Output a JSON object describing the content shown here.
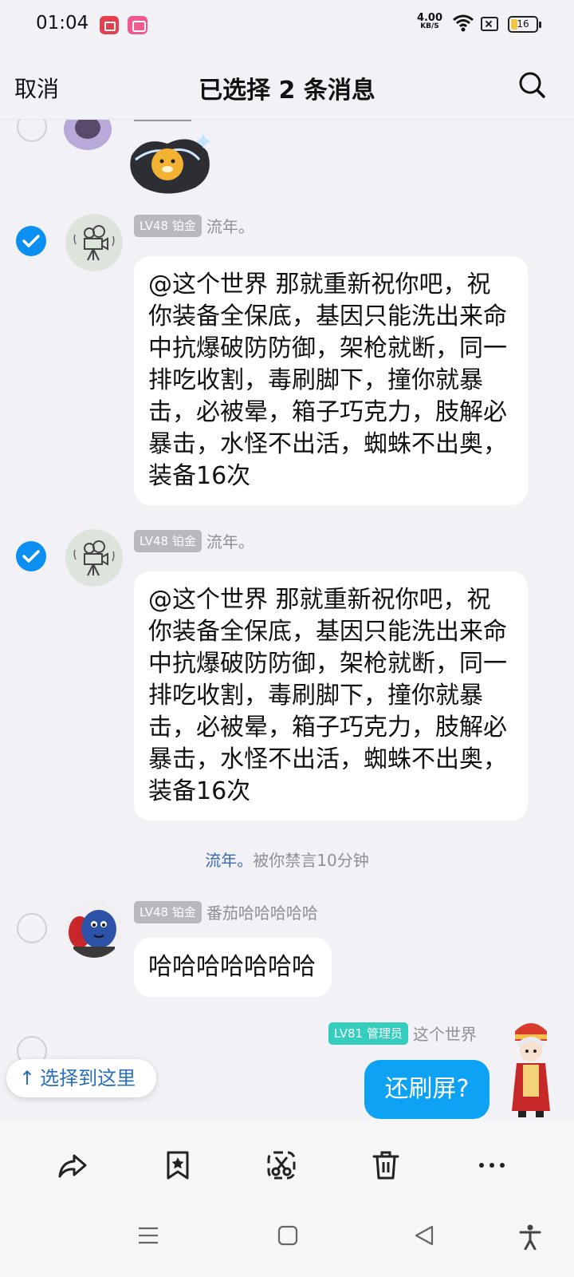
{
  "status_bar": {
    "time": "01:04",
    "net_speed_value": "4.00",
    "net_speed_unit": "KB/S",
    "battery": "16",
    "icons": [
      "screen-record-icon",
      "bilibili-app-icon",
      "wifi-icon",
      "no-sim-icon",
      "battery-icon"
    ]
  },
  "header": {
    "cancel_label": "取消",
    "title": "已选择 2 条消息",
    "search_icon": "search-icon"
  },
  "messages": [
    {
      "selected": true,
      "badge": "LV48 铂金",
      "nickname": "流年。",
      "text": "@这个世界 那就重新祝你吧，祝你装备全保底，基因只能洗出来命中抗爆破防防御，架枪就断，同一排吃收割，毒刷脚下，撞你就暴击，必被晕，箱子巧克力，肢解必暴击，水怪不出活，蜘蛛不出奥，装备16次"
    },
    {
      "selected": true,
      "badge": "LV48 铂金",
      "nickname": "流年。",
      "text": "@这个世界 那就重新祝你吧，祝你装备全保底，基因只能洗出来命中抗爆破防防御，架枪就断，同一排吃收割，毒刷脚下，撞你就暴击，必被晕，箱子巧克力，肢解必暴击，水怪不出活，蜘蛛不出奥，装备16次"
    },
    {
      "selected": false,
      "badge": "LV48 铂金",
      "nickname": "番茄哈哈哈哈哈",
      "text": "哈哈哈哈哈哈哈"
    },
    {
      "selected": false,
      "badge": "LV81 管理员",
      "nickname": "这个世界",
      "text": "还刷屏?"
    }
  ],
  "system_notice": {
    "who": "流年。",
    "text": "被你禁言10分钟"
  },
  "select_here_label": "选择到这里",
  "colors": {
    "accent_blue": "#0b8ff2",
    "bubble_blue": "#0ea2f5",
    "badge_gray": "#b9b8bd",
    "badge_teal": "#35cdbe",
    "background": "#f2f2f6"
  },
  "toolbar_icons": [
    "share-icon",
    "bookmark-icon",
    "screenshot-cut-icon",
    "delete-icon",
    "more-icon"
  ],
  "nav_icons": [
    "menu-icon",
    "home-icon",
    "back-icon",
    "accessibility-icon"
  ]
}
